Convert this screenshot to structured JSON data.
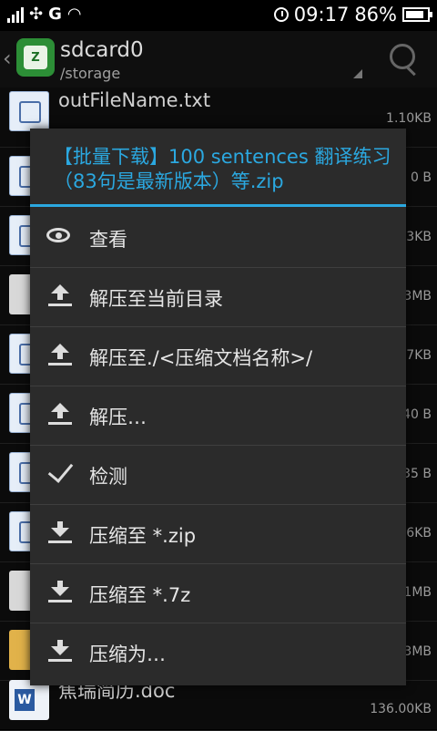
{
  "status": {
    "network": "G",
    "time": "09:17",
    "battery": "86%"
  },
  "header": {
    "title": "sdcard0",
    "subtitle": "/storage"
  },
  "files": [
    {
      "name": "outFileName.txt",
      "size": "1.10KB",
      "icon": "doc"
    },
    {
      "name": "",
      "size": "0 B",
      "icon": "doc"
    },
    {
      "name": "",
      "size": "3KB",
      "icon": "doc"
    },
    {
      "name": "",
      "size": "3MB",
      "icon": "gray"
    },
    {
      "name": "",
      "size": "7KB",
      "icon": "doc"
    },
    {
      "name": "",
      "size": "40 B",
      "icon": "doc"
    },
    {
      "name": "",
      "size": "35 B",
      "icon": "doc"
    },
    {
      "name": "",
      "size": "6KB",
      "icon": "doc"
    },
    {
      "name": "",
      "size": "1MB",
      "icon": "gray"
    },
    {
      "name": "",
      "size": "3MB",
      "icon": "zip"
    },
    {
      "name": "焦瑞简历.doc",
      "size": "136.00KB",
      "icon": "word"
    }
  ],
  "dialog": {
    "title": "【批量下载】100 sentences 翻译练习（83句是最新版本）等.zip",
    "items": [
      {
        "label": "查看",
        "icon": "eye-icon"
      },
      {
        "label": "解压至当前目录",
        "icon": "extract-icon"
      },
      {
        "label": "解压至./<压缩文档名称>/",
        "icon": "extract-icon"
      },
      {
        "label": "解压…",
        "icon": "extract-icon"
      },
      {
        "label": "检测",
        "icon": "check-icon"
      },
      {
        "label": "压缩至 *.zip",
        "icon": "compress-icon"
      },
      {
        "label": "压缩至 *.7z",
        "icon": "compress-icon"
      },
      {
        "label": "压缩为…",
        "icon": "compress-icon"
      }
    ]
  }
}
